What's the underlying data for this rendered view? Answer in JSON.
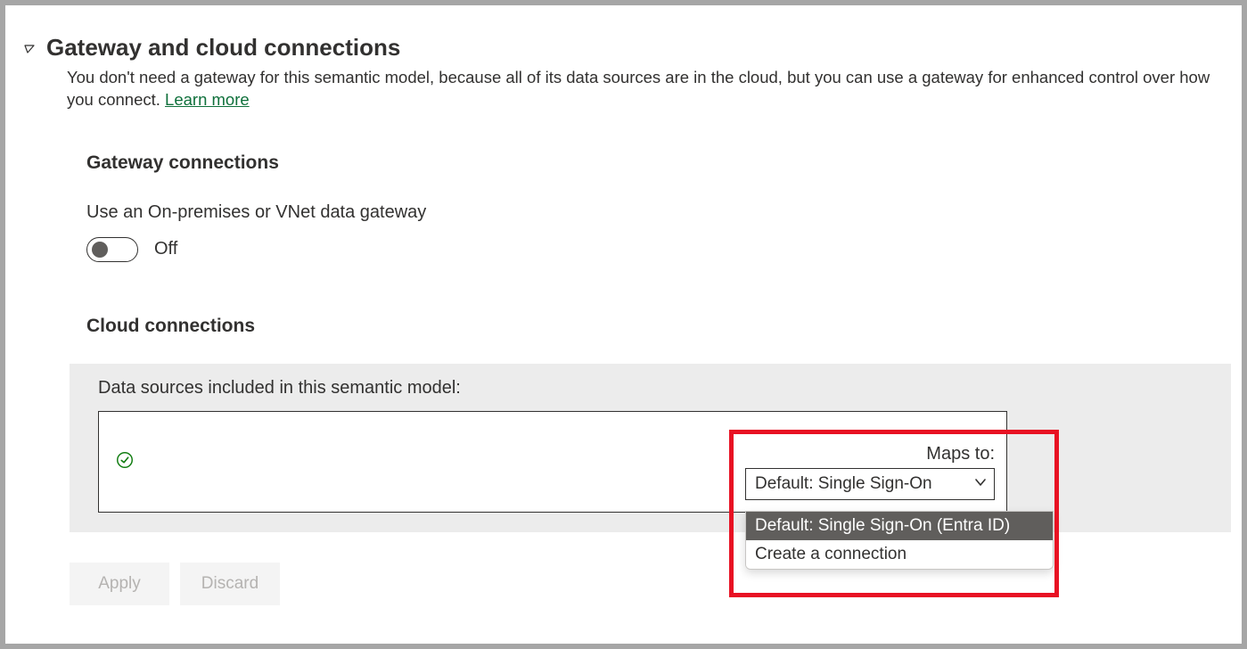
{
  "section": {
    "title": "Gateway and cloud connections",
    "description_pre": "You don't need a gateway for this semantic model, because all of its data sources are in the cloud, but you can use a gateway for enhanced control over how you connect. ",
    "learn_more": "Learn more"
  },
  "gateway": {
    "title": "Gateway connections",
    "toggle_label": "Use an On-premises or VNet data gateway",
    "toggle_state": "Off"
  },
  "cloud": {
    "title": "Cloud connections",
    "panel_label": "Data sources included in this semantic model:",
    "maps_to_label": "Maps to:",
    "select_value": "Default: Single Sign-On",
    "options": [
      "Default: Single Sign-On (Entra ID)",
      "Create a connection"
    ]
  },
  "footer": {
    "apply": "Apply",
    "discard": "Discard"
  },
  "icons": {
    "collapse": "collapse-icon",
    "check": "check-icon",
    "chevron": "chevron-down-icon"
  }
}
